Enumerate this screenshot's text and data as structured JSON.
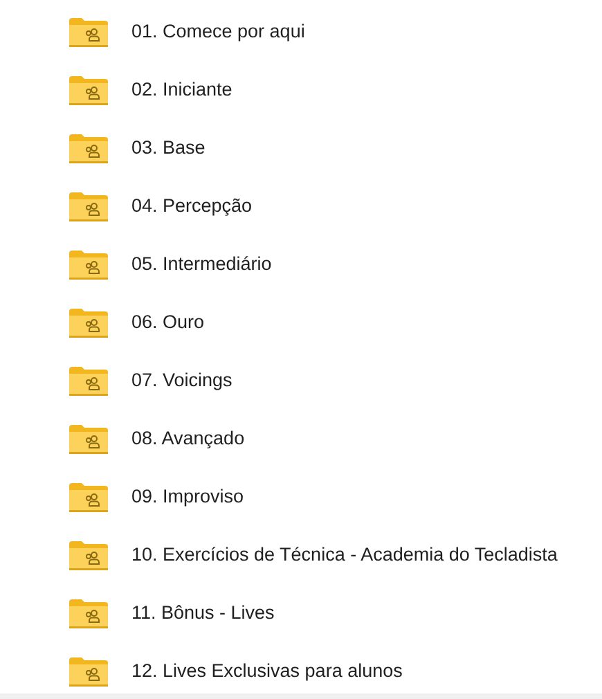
{
  "folders": [
    {
      "name": "01. Comece por aqui"
    },
    {
      "name": "02. Iniciante"
    },
    {
      "name": "03. Base"
    },
    {
      "name": "04. Percepção"
    },
    {
      "name": "05. Intermediário"
    },
    {
      "name": "06. Ouro"
    },
    {
      "name": "07. Voicings"
    },
    {
      "name": "08. Avançado"
    },
    {
      "name": "09. Improviso"
    },
    {
      "name": "10. Exercícios de Técnica - Academia do Tecladista"
    },
    {
      "name": "11. Bônus - Lives"
    },
    {
      "name": "12. Lives Exclusivas para alunos"
    }
  ]
}
